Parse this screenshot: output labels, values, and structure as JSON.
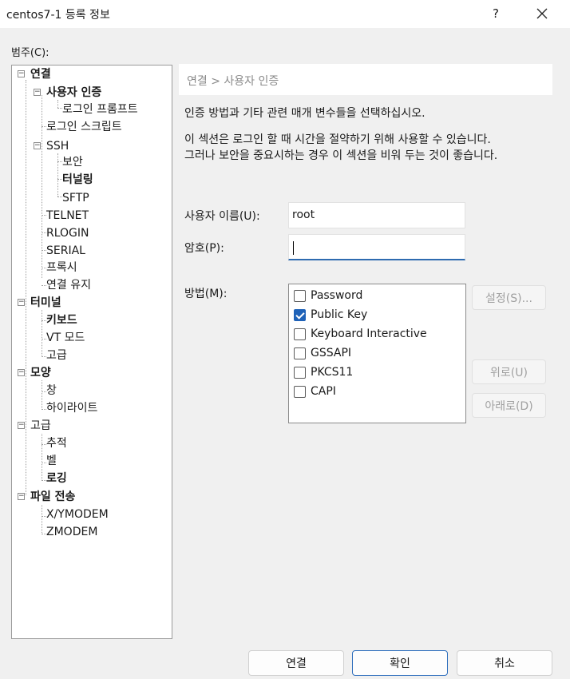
{
  "window": {
    "title": "centos7-1 등록 정보",
    "help_label": "?"
  },
  "category_label": "범주(C):",
  "tree": {
    "items": [
      {
        "label": "연결"
      },
      {
        "label": "사용자 인증"
      },
      {
        "label": "로그인 프롬프트"
      },
      {
        "label": "로그인 스크립트"
      },
      {
        "label": "SSH"
      },
      {
        "label": "보안"
      },
      {
        "label": "터널링"
      },
      {
        "label": "SFTP"
      },
      {
        "label": "TELNET"
      },
      {
        "label": "RLOGIN"
      },
      {
        "label": "SERIAL"
      },
      {
        "label": "프록시"
      },
      {
        "label": "연결 유지"
      },
      {
        "label": "터미널"
      },
      {
        "label": "키보드"
      },
      {
        "label": "VT 모드"
      },
      {
        "label": "고급"
      },
      {
        "label": "모양"
      },
      {
        "label": "창"
      },
      {
        "label": "하이라이트"
      },
      {
        "label": "고급"
      },
      {
        "label": "추적"
      },
      {
        "label": "벨"
      },
      {
        "label": "로깅"
      },
      {
        "label": "파일 전송"
      },
      {
        "label": "X/YMODEM"
      },
      {
        "label": "ZMODEM"
      }
    ],
    "selected": "사용자 인증"
  },
  "panel": {
    "breadcrumb": "연결 > 사용자 인증",
    "description": "인증 방법과 기타 관련 매개 변수들을 선택하십시오.",
    "note_line1": "이 섹션은 로그인 할 때 시간을 절약하기 위해 사용할 수 있습니다.",
    "note_line2": "그러나 보안을 중요시하는 경우 이 섹션을 비워 두는 것이 좋습니다.",
    "username_label": "사용자 이름(U):",
    "username_value": "root",
    "password_label": "암호(P):",
    "password_value": "",
    "method_label": "방법(M):",
    "methods": [
      {
        "label": "Password",
        "checked": false
      },
      {
        "label": "Public Key",
        "checked": true
      },
      {
        "label": "Keyboard Interactive",
        "checked": false
      },
      {
        "label": "GSSAPI",
        "checked": false
      },
      {
        "label": "PKCS11",
        "checked": false
      },
      {
        "label": "CAPI",
        "checked": false
      }
    ],
    "settings_button": "설정(S)...",
    "up_button": "위로(U)",
    "down_button": "아래로(D)"
  },
  "footer": {
    "connect_button": "연결",
    "ok_button": "확인",
    "cancel_button": "취소"
  },
  "colors": {
    "accent": "#1f62b8",
    "header_band": "#ffffff",
    "disabled_text": "#a0a0a0"
  }
}
